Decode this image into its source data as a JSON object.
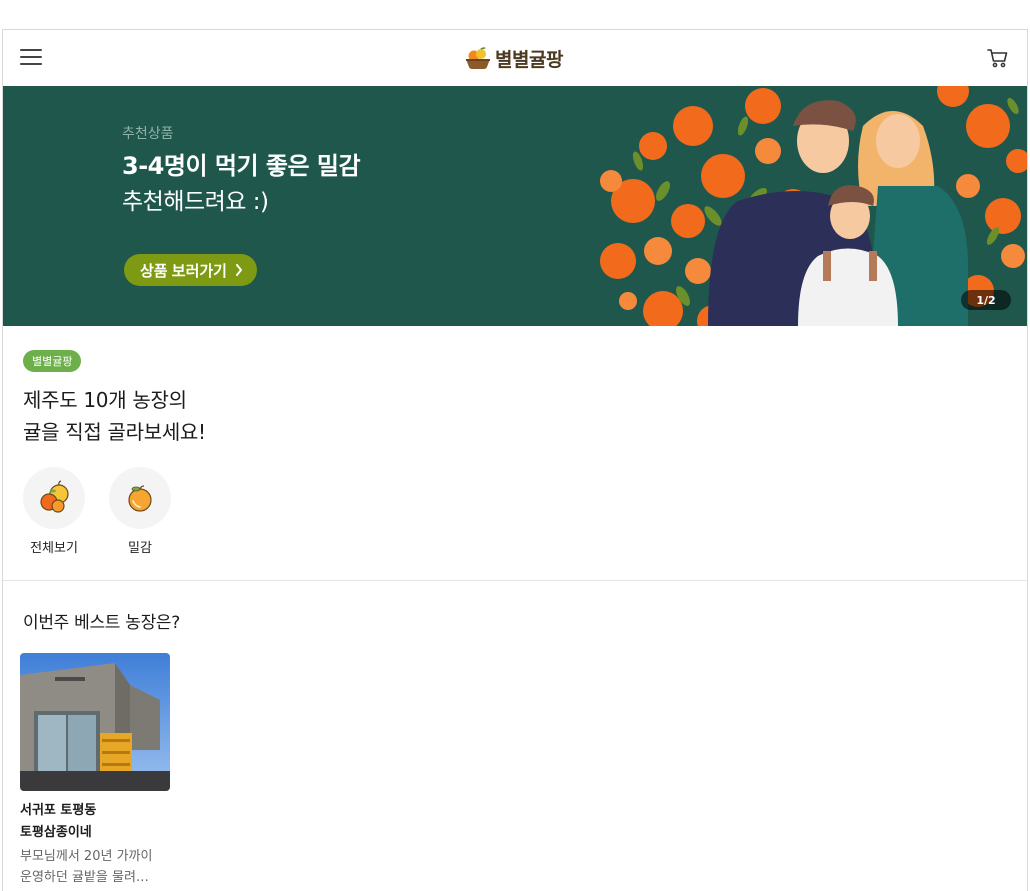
{
  "brand": {
    "name": "별별귤팡",
    "logo_icon": "tangerine-basket-icon"
  },
  "header": {
    "menu_icon": "hamburger-icon",
    "cart_icon": "cart-icon"
  },
  "banner": {
    "eyebrow": "추천상품",
    "title": "3-4명이 먹기 좋은 밀감",
    "subtitle": "추천해드려요 :)",
    "cta_label": "상품 보러가기",
    "pager": "1/2",
    "bg_color": "#1f574d",
    "cta_color": "#7d9a12"
  },
  "intro": {
    "badge": "별별귤팡",
    "title_line1": "제주도 10개 농장의",
    "title_line2": "귤을 직접 골라보세요!",
    "categories": [
      {
        "label": "전체보기",
        "icon": "mixed-citrus-icon"
      },
      {
        "label": "밀감",
        "icon": "tangerine-icon"
      }
    ]
  },
  "best": {
    "title": "이번주 베스트 농장은?",
    "farms": [
      {
        "region": "서귀포 토평동",
        "name": "토평삼종이네",
        "desc_line1": "부모님께서 20년 가까이",
        "desc_line2": "운영하던 귤밭을 물려…"
      }
    ]
  }
}
